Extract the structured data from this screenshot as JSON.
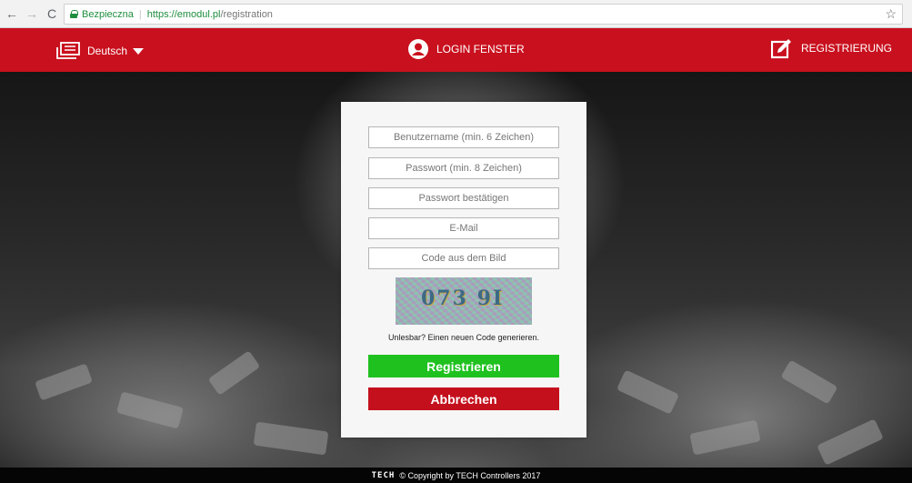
{
  "browser": {
    "secure_label": "Bezpieczna",
    "url_main": "https://emodul.pl",
    "url_path": "/registration"
  },
  "header": {
    "language": "Deutsch",
    "login": "LOGIN FENSTER",
    "register": "REGISTRIERUNG"
  },
  "form": {
    "username_placeholder": "Benutzername (min. 6 Zeichen)",
    "password_placeholder": "Passwort (min. 8 Zeichen)",
    "confirm_placeholder": "Passwort bestätigen",
    "email_placeholder": "E-Mail",
    "captcha_placeholder": "Code aus dem Bild",
    "captcha_text": "073 9I",
    "refresh_text": "Unlesbar? Einen neuen Code generieren.",
    "register_button": "Registrieren",
    "cancel_button": "Abbrechen"
  },
  "footer": {
    "brand": "TECH",
    "copyright": "© Copyright by TECH Controllers 2017"
  },
  "colors": {
    "header_red": "#c9101e",
    "register_green": "#1fc11f",
    "cancel_red": "#c4101d"
  }
}
